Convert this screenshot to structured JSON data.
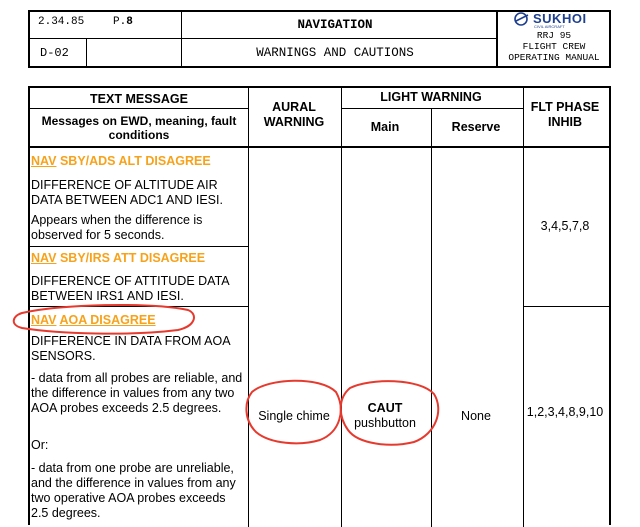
{
  "header": {
    "revision": "2.34.85",
    "page_label": "P.",
    "page_number": "8",
    "section_code": "D-02",
    "title": "NAVIGATION",
    "subtitle": "WARNINGS AND CAUTIONS",
    "brand": "SUKHOI",
    "brand_sub": "CIVIL AIRCRAFT",
    "aircraft": "RRJ 95",
    "manual_line1": "FLIGHT CREW",
    "manual_line2": "OPERATING MANUAL"
  },
  "table": {
    "col_text_message": "TEXT MESSAGE",
    "col_text_sub": "Messages on EWD, meaning, fault conditions",
    "col_aural": "AURAL WARNING",
    "col_light": "LIGHT WARNING",
    "col_main": "Main",
    "col_reserve": "Reserve",
    "col_flt_phase": "FLT PHASE INHIB",
    "rows": [
      {
        "prefix": "NAV",
        "message": "SBY/ADS ALT DISAGREE",
        "meaning": "DIFFERENCE OF ALTITUDE AIR DATA BETWEEN ADC1 AND IESI.",
        "condition": "Appears when the difference is observed for 5 seconds."
      },
      {
        "prefix": "NAV",
        "message": "SBY/IRS ATT DISAGREE",
        "meaning": "DIFFERENCE OF ATTITUDE DATA BETWEEN IRS1 AND IESI."
      },
      {
        "prefix": "NAV",
        "message": "AOA DISAGREE",
        "meaning": "DIFFERENCE IN DATA FROM AOA SENSORS.",
        "condition1": "- data from all probes are reliable, and the difference in values from any two AOA probes exceeds 2.5 degrees.",
        "or": "Or:",
        "condition2": "- data from one probe are unreliable, and the difference in values from any two operative AOA probes exceeds 2.5 degrees."
      }
    ],
    "group1_flt_phase": "3,4,5,7,8",
    "row3_aural": "Single chime",
    "row3_main_bold": "CAUT",
    "row3_main_sub": "pushbutton",
    "row3_reserve": "None",
    "row3_flt_phase": "1,2,3,4,8,9,10"
  },
  "colors": {
    "nav_message": "#f7a21b",
    "annotation_circle": "#e63a2e",
    "brand_blue": "#1e3f8f"
  }
}
